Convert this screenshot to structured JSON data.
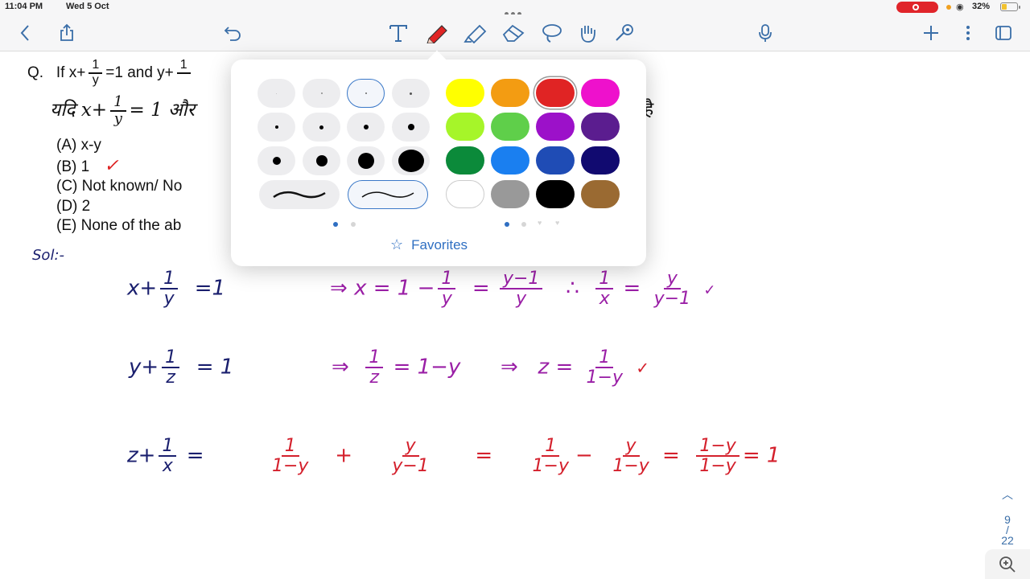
{
  "status_bar": {
    "time": "11:04 PM",
    "date": "Wed 5 Oct",
    "battery": "32%"
  },
  "question": {
    "line1_prefix": "Q.",
    "line1": "If x+",
    "line1_frac_num": "1",
    "line1_frac_den": "y",
    "line1_mid": "=1 and y+",
    "line1_frac2_num": "1",
    "hindi_prefix": "यदि x+",
    "hindi_frac_num": "1",
    "hindi_frac_den": "y",
    "hindi_mid": "= 1 और",
    "hindi_end": "है",
    "options": [
      {
        "label": "(A) x-y"
      },
      {
        "label": "(B) 1",
        "tick": "✓"
      },
      {
        "label": "(C) Not known/ No"
      },
      {
        "label": "(D) 2"
      },
      {
        "label": "(E) None of the ab"
      }
    ]
  },
  "solution": {
    "label": "Sol:-",
    "eq1": {
      "lhs_var": "x+",
      "lhs_num": "1",
      "lhs_den": "y",
      "lhs_eq": "=1",
      "arrow": "⇒",
      "step": "x = 1 −",
      "step_num": "1",
      "step_den": "y",
      "eq2": "=",
      "step2_num": "y−1",
      "step2_den": "y",
      "therefore": "∴",
      "rhs_num": "1",
      "rhs_den": "x",
      "rhs_eq": "=",
      "rhs2_num": "y",
      "rhs2_den": "y−1",
      "tick": "✓"
    },
    "eq2": {
      "lhs_var": "y+",
      "lhs_num": "1",
      "lhs_den": "z",
      "lhs_eq": "= 1",
      "arrow": "⇒",
      "step_num": "1",
      "step_den": "z",
      "step": "= 1−y",
      "arrow2": "⇒",
      "res": "z =",
      "res_num": "1",
      "res_den": "1−y",
      "tick": "✓"
    },
    "eq3": {
      "lhs_var": "z+",
      "lhs_num": "1",
      "lhs_den": "x",
      "lhs_eq": "=",
      "t1_num": "1",
      "t1_den": "1−y",
      "plus": "+",
      "t2_num": "y",
      "t2_den": "y−1",
      "eq": "=",
      "t3_num": "1",
      "t3_den": "1−y",
      "minus": "−",
      "t4_num": "y",
      "t4_den": "1−y",
      "eq2": "=",
      "t5_num": "1−y",
      "t5_den": "1−y",
      "result": "= 1"
    }
  },
  "popup": {
    "favorites_label": "Favorites",
    "colors": [
      "#ffff00",
      "#f39c12",
      "#e02424",
      "#ee11cc",
      "#a6f529",
      "#5fcf4a",
      "#9c11c9",
      "#5b1d8f",
      "#0b8a3a",
      "#1a7ff0",
      "#1f4cb5",
      "#110a70",
      "#ffffff",
      "#999999",
      "#000000",
      "#9a6a32"
    ],
    "selected_color": "#e02424"
  },
  "page_nav": {
    "current": "9",
    "total": "22"
  },
  "icons": [
    "back-icon",
    "share-icon",
    "undo-icon",
    "text-tool-icon",
    "pen-tool-icon",
    "highlighter-icon",
    "eraser-icon",
    "lasso-icon",
    "hand-tool-icon",
    "shapes-tool-icon",
    "microphone-icon",
    "add-icon",
    "more-icon",
    "pages-icon",
    "zoom-icon"
  ]
}
